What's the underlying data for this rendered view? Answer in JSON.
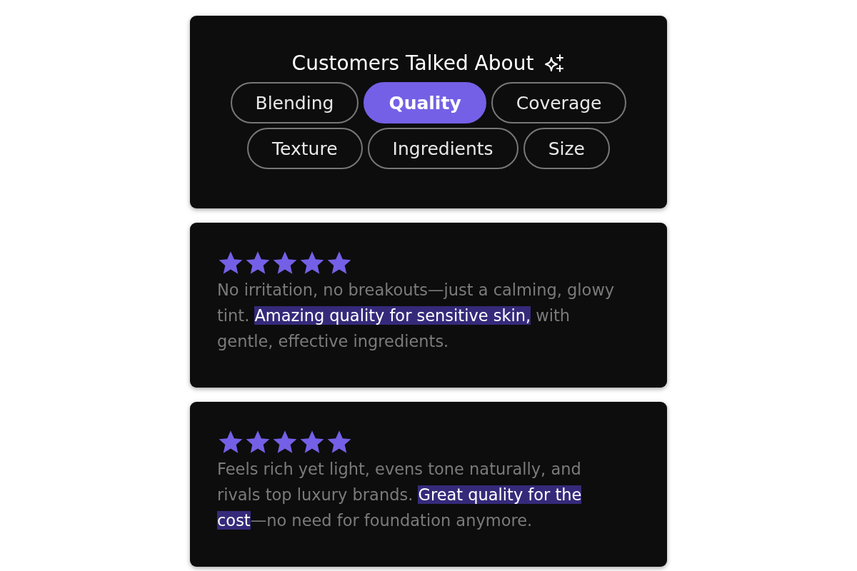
{
  "topics": {
    "title": "Customers Talked About",
    "chips": [
      {
        "label": "Blending",
        "selected": false
      },
      {
        "label": "Quality",
        "selected": true
      },
      {
        "label": "Coverage",
        "selected": false
      },
      {
        "label": "Texture",
        "selected": false
      },
      {
        "label": "Ingredients",
        "selected": false
      },
      {
        "label": "Size",
        "selected": false
      }
    ]
  },
  "reviews": [
    {
      "stars": 5,
      "before": "No irritation, no breakouts—just a calming, glowy tint. ",
      "highlight": "Amazing quality for sensitive skin,",
      "after": " with gentle, effective ingredients."
    },
    {
      "stars": 5,
      "before": "Feels rich yet light, evens tone naturally, and rivals top luxury brands. ",
      "highlight": "Great quality for the cost",
      "after": "—no need for foundation anymore."
    }
  ]
}
